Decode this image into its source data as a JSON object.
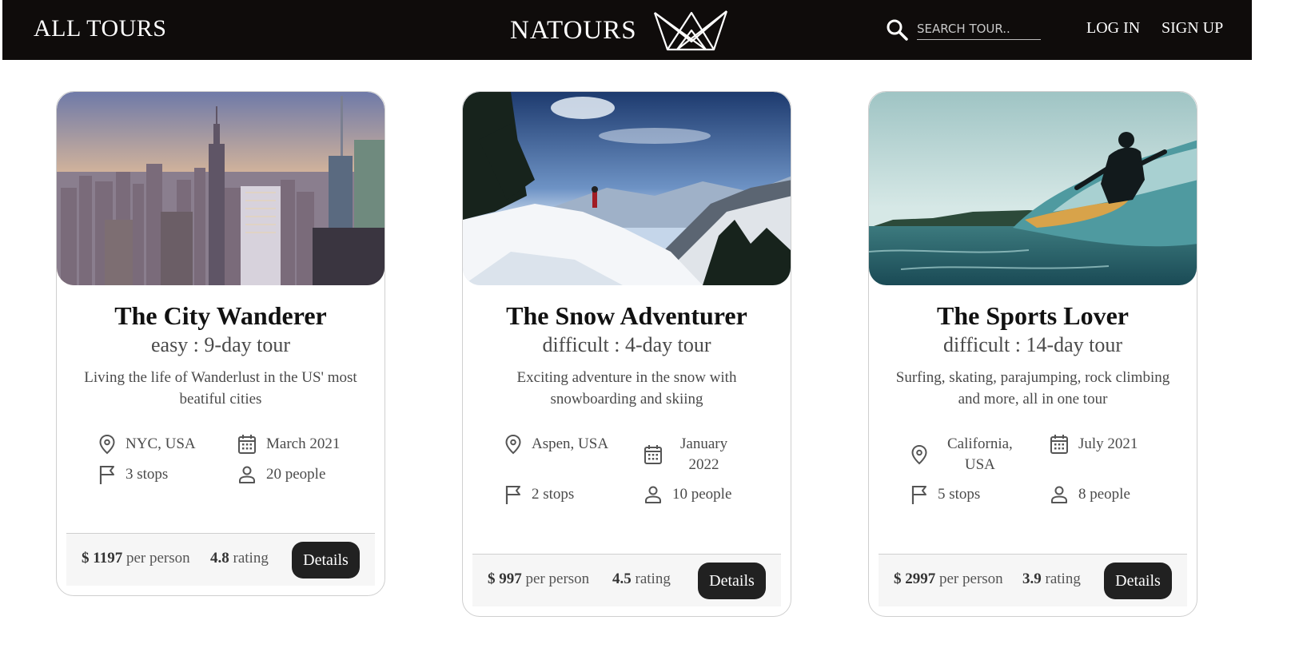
{
  "header": {
    "all_tours": "ALL TOURS",
    "brand": "NATOURS",
    "search_placeholder": "SEARCH TOUR..",
    "login": "LOG IN",
    "signup": "SIGN UP"
  },
  "tours": [
    {
      "title": "The City Wanderer",
      "subtitle": "easy : 9-day tour",
      "description": "Living the life of Wanderlust in the US' most beatiful cities",
      "location": "NYC, USA",
      "date": "March 2021",
      "stops": "3 stops",
      "people": "20 people",
      "price": "$ 1197",
      "price_suffix": " per person",
      "rating": "4.8",
      "rating_suffix": " rating",
      "button": "Details"
    },
    {
      "title": "The Snow Adventurer",
      "subtitle": "difficult : 4-day tour",
      "description": "Exciting adventure in the snow with snowboarding and skiing",
      "location": "Aspen, USA",
      "date_line1": "January",
      "date_line2": "2022",
      "stops": "2 stops",
      "people": "10 people",
      "price": "$ 997",
      "price_suffix": " per person",
      "rating": "4.5",
      "rating_suffix": " rating",
      "button": "Details"
    },
    {
      "title": "The Sports Lover",
      "subtitle": "difficult : 14-day tour",
      "description": "Surfing, skating, parajumping, rock climbing and more, all in one tour",
      "location_line1": "California,",
      "location_line2": "USA",
      "date": "July 2021",
      "stops": "5 stops",
      "people": "8 people",
      "price": "$ 2997",
      "price_suffix": " per person",
      "rating": "3.9",
      "rating_suffix": " rating",
      "button": "Details"
    }
  ],
  "icons": {
    "location": "map-pin-icon",
    "date": "calendar-icon",
    "stops": "flag-icon",
    "people": "user-icon",
    "search": "search-icon",
    "logo": "crown-logo"
  }
}
